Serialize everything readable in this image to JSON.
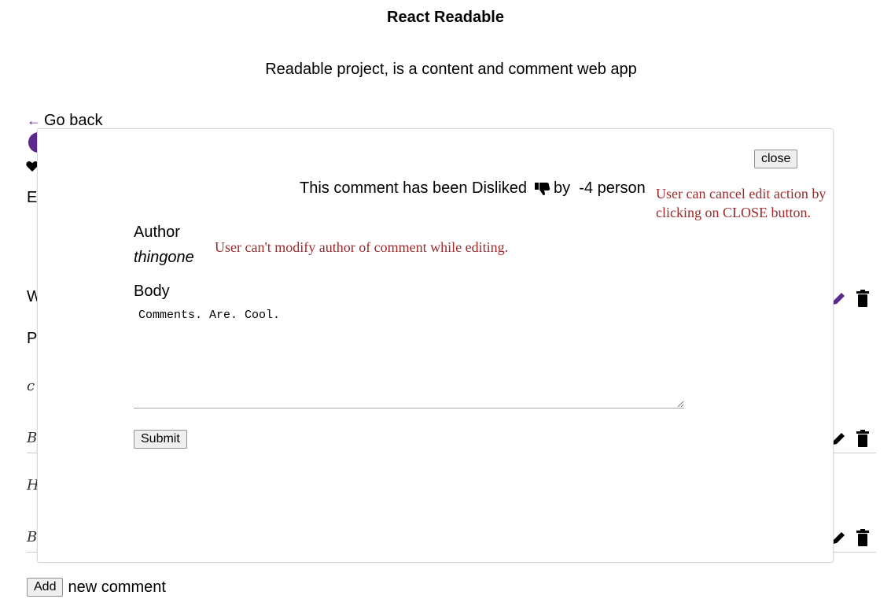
{
  "header": {
    "title": "React Readable",
    "subtitle": "Readable project, is a content and comment web app"
  },
  "nav": {
    "back_arrow": "←",
    "back_label": "Go back"
  },
  "background": {
    "fragment_e": "E",
    "fragment_w": "W",
    "fragment_p": "P",
    "fragment_c": "c",
    "fragment_b1": "B",
    "fragment_h": "H",
    "fragment_b2": "B",
    "icons": [
      "heart-icon",
      "pencil-icon",
      "trash-icon"
    ],
    "accent": "#5b2a8c"
  },
  "modal": {
    "close_label": "close",
    "status_prefix": "This comment has been Disliked",
    "status_by": "by",
    "status_count": "-4",
    "status_suffix": "person",
    "author_label": "Author",
    "author_value": "thingone",
    "body_label": "Body",
    "body_value": "Comments. Are. Cool.",
    "submit_label": "Submit"
  },
  "annotations": {
    "close_note": "User can cancel edit action by clicking on CLOSE button.",
    "author_note": "User can't modify author of comment while editing.",
    "color": "#9b2a2a"
  },
  "footer": {
    "add_label": "Add",
    "add_text": "new comment"
  }
}
